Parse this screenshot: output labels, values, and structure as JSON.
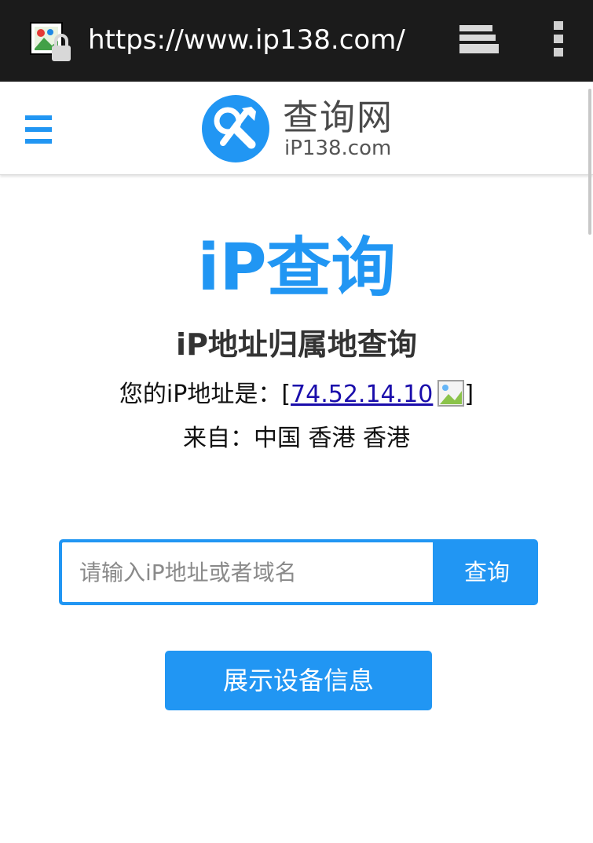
{
  "browser": {
    "url": "https://www.ip138.com/",
    "icons": [
      "secure-site-icon",
      "tabs-icon",
      "overflow-menu-icon"
    ]
  },
  "header": {
    "menu_icon": "hamburger-icon",
    "logo_icon": "tools-logo-icon",
    "logo_cn": "查询网",
    "logo_en": "iP138.com"
  },
  "main": {
    "hero_title": "iP查询",
    "subtitle": "iP地址归属地查询",
    "ip_prefix": "您的iP地址是：[",
    "ip_address": "74.52.14.10",
    "ip_suffix": "]",
    "from_text": "来自：中国 香港 香港"
  },
  "search": {
    "placeholder": "请输入iP地址或者域名",
    "value": "",
    "button_label": "查询"
  },
  "device_button_label": "展示设备信息",
  "colors": {
    "accent": "#2196f3",
    "browser_bar": "#1b1b1b",
    "link": "#1a0dab"
  }
}
